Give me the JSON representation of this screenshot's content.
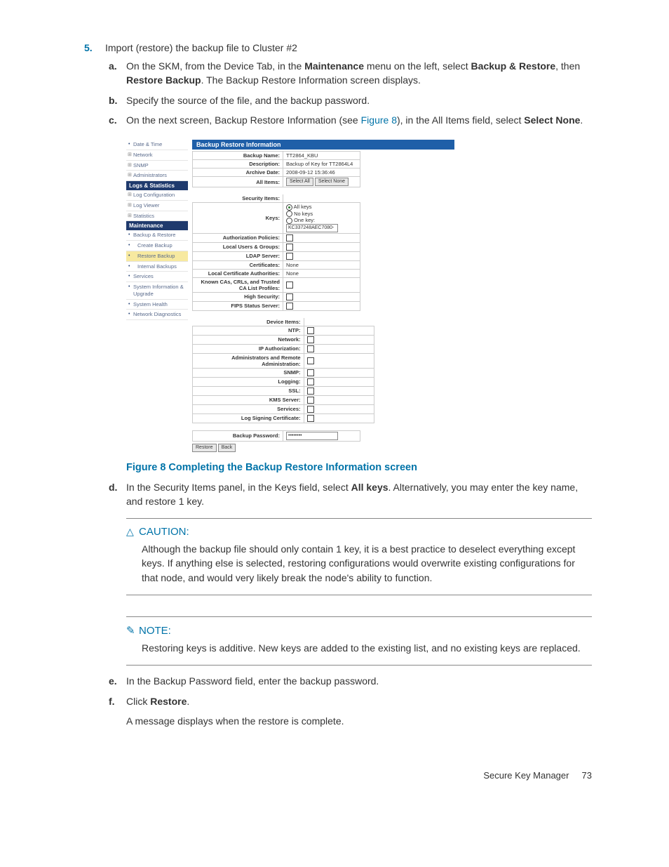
{
  "step5": {
    "text": "Import (restore) the backup file to Cluster #2",
    "a": {
      "pre": "On the SKM, from the Device Tab, in the ",
      "b1": "Maintenance",
      "mid1": " menu on the left, select ",
      "b2": "Backup & Restore",
      "mid2": ", then ",
      "b3": "Restore Backup",
      "post": ". The Backup Restore Information screen displays."
    },
    "b": "Specify the source of the file, and the backup password.",
    "c": {
      "pre": "On the next screen, Backup Restore Information (see ",
      "link": "Figure 8",
      "mid": "), in the All Items field, select ",
      "bold": "Select None",
      "post": "."
    },
    "d": {
      "pre": "In the Security Items panel, in the Keys field, select ",
      "bold": "All keys",
      "post": ". Alternatively, you may enter the key name, and restore 1 key."
    },
    "e": "In the Backup Password field, enter the backup password.",
    "f": {
      "pre": "Click ",
      "bold": "Restore",
      "post": "."
    },
    "f_after": "A message displays when the restore is complete."
  },
  "figure_caption": "Figure 8 Completing the Backup Restore Information screen",
  "caution": {
    "head": "CAUTION:",
    "body": "Although the backup file should only contain 1 key, it is a best practice to deselect everything except keys. If anything else is selected, restoring configurations would overwrite existing configurations for that node, and would very likely break the node's ability to function."
  },
  "note": {
    "head": "NOTE:",
    "body": "Restoring keys is additive. New keys are added to the existing list, and no existing keys are replaced."
  },
  "footer": {
    "title": "Secure Key Manager",
    "page": "73"
  },
  "shot": {
    "nav": {
      "items_top": [
        "Date & Time",
        "Network",
        "SNMP",
        "Administrators"
      ],
      "sec_logs": "Logs & Statistics",
      "items_logs": [
        "Log Configuration",
        "Log Viewer",
        "Statistics"
      ],
      "sec_maint": "Maintenance",
      "items_maint": [
        "Backup & Restore",
        "Create Backup",
        "Restore Backup",
        "Internal Backups",
        "Services",
        "System Information & Upgrade",
        "System Health",
        "Network Diagnostics"
      ]
    },
    "panel_title": "Backup Restore Information",
    "top_rows": {
      "backup_name_k": "Backup Name:",
      "backup_name_v": "TT2864_KBU",
      "description_k": "Description:",
      "description_v": "Backup of Key for TT2864L4",
      "archive_k": "Archive Date:",
      "archive_v": "2008-09-12 15:36:46",
      "allitems_k": "All Items:",
      "btn_all": "Select All",
      "btn_none": "Select None"
    },
    "security_items_h": "Security Items:",
    "keys": {
      "label": "Keys:",
      "all": "All keys",
      "no": "No keys",
      "one": "One key:",
      "val": "KC337248AEC7080-"
    },
    "sec_rows": {
      "auth": "Authorization Policies:",
      "users": "Local Users & Groups:",
      "ldap": "LDAP Server:",
      "certs_k": "Certificates:",
      "certs_v": "None",
      "lca_k": "Local Certificate Authorities:",
      "lca_v": "None",
      "known": "Known CAs, CRLs, and Trusted CA List Profiles:",
      "high": "High Security:",
      "fips": "FIPS Status Server:"
    },
    "device_items_h": "Device Items:",
    "dev_rows": [
      "NTP:",
      "Network:",
      "IP Authorization:",
      "Administrators and Remote Administration:",
      "SNMP:",
      "Logging:",
      "SSL:",
      "KMS Server:",
      "Services:",
      "Log Signing Certificate:"
    ],
    "pw_label": "Backup Password:",
    "pw_value": "••••••••",
    "btn_restore": "Restore",
    "btn_back": "Back"
  }
}
